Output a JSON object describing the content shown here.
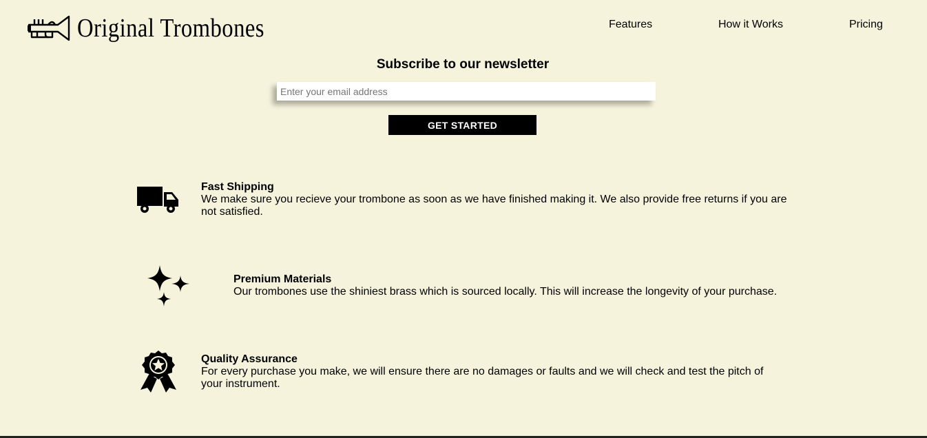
{
  "header": {
    "brand": "Original Trombones",
    "logo_icon": "trumpet-icon",
    "nav": [
      "Features",
      "How it Works",
      "Pricing"
    ]
  },
  "newsletter": {
    "title": "Subscribe to our newsletter",
    "email_placeholder": "Enter your email address",
    "email_value": "",
    "button_label": "GET STARTED"
  },
  "features": [
    {
      "icon": "truck-icon",
      "title": "Fast Shipping",
      "text": "We make sure you recieve your trombone as soon as we have finished making it. We also provide free returns if you are not satisfied."
    },
    {
      "icon": "sparkles-icon",
      "title": "Premium Materials",
      "text": "Our trombones use the shiniest brass which is sourced locally. This will increase the longevity of your purchase."
    },
    {
      "icon": "award-badge-icon",
      "title": "Quality Assurance",
      "text": "For every purchase you make, we will ensure there are no damages or faults and we will check and test the pitch of your instrument."
    }
  ],
  "colors": {
    "background": "#f5f3dc",
    "button": "#000000",
    "button_text": "#ffffff"
  }
}
